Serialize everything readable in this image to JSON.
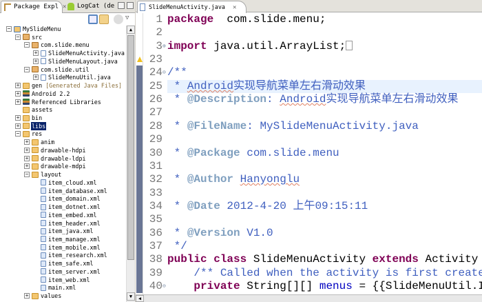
{
  "left_panel": {
    "tabs": [
      {
        "label": "Package Expl",
        "close": "✕",
        "icon": "package-explorer-icon"
      },
      {
        "label": "LogCat (depr",
        "icon": "android-icon"
      }
    ],
    "tree": [
      {
        "level": 0,
        "toggle": "-",
        "icon": "proj",
        "label": "MySlideMenu"
      },
      {
        "level": 1,
        "toggle": "-",
        "icon": "pkg",
        "label": "src"
      },
      {
        "level": 2,
        "toggle": "-",
        "icon": "pkg",
        "label": "com.slide.menu"
      },
      {
        "level": 3,
        "toggle": "+",
        "icon": "java",
        "label": "SlideMenuActivity.java"
      },
      {
        "level": 3,
        "toggle": "+",
        "icon": "java",
        "label": "SlideMenuLayout.java"
      },
      {
        "level": 2,
        "toggle": "-",
        "icon": "pkg",
        "label": "com.slide.util"
      },
      {
        "level": 3,
        "toggle": "+",
        "icon": "java",
        "label": "SlideMenuUtil.java"
      },
      {
        "level": 1,
        "toggle": "+",
        "icon": "folder",
        "label": "gen",
        "extra": "[Generated Java Files]"
      },
      {
        "level": 1,
        "toggle": "+",
        "icon": "lib",
        "label": "Android 2.2"
      },
      {
        "level": 1,
        "toggle": "+",
        "icon": "lib",
        "label": "Referenced Libraries"
      },
      {
        "level": 1,
        "toggle": "",
        "icon": "folder",
        "label": "assets"
      },
      {
        "level": 1,
        "toggle": "+",
        "icon": "folder",
        "label": "bin"
      },
      {
        "level": 1,
        "toggle": "+",
        "icon": "folder",
        "label": "libs",
        "selected": true
      },
      {
        "level": 1,
        "toggle": "-",
        "icon": "folder",
        "label": "res"
      },
      {
        "level": 2,
        "toggle": "+",
        "icon": "folder",
        "label": "anim"
      },
      {
        "level": 2,
        "toggle": "+",
        "icon": "folder",
        "label": "drawable-hdpi"
      },
      {
        "level": 2,
        "toggle": "+",
        "icon": "folder",
        "label": "drawable-ldpi"
      },
      {
        "level": 2,
        "toggle": "+",
        "icon": "folder",
        "label": "drawable-mdpi"
      },
      {
        "level": 2,
        "toggle": "-",
        "icon": "folder",
        "label": "layout"
      },
      {
        "level": 3,
        "toggle": "",
        "icon": "xml",
        "label": "item_cloud.xml"
      },
      {
        "level": 3,
        "toggle": "",
        "icon": "xml",
        "label": "item_database.xml"
      },
      {
        "level": 3,
        "toggle": "",
        "icon": "xml",
        "label": "item_domain.xml"
      },
      {
        "level": 3,
        "toggle": "",
        "icon": "xml",
        "label": "item_dotnet.xml"
      },
      {
        "level": 3,
        "toggle": "",
        "icon": "xml",
        "label": "item_embed.xml"
      },
      {
        "level": 3,
        "toggle": "",
        "icon": "xml",
        "label": "item_header.xml"
      },
      {
        "level": 3,
        "toggle": "",
        "icon": "xml",
        "label": "item_java.xml"
      },
      {
        "level": 3,
        "toggle": "",
        "icon": "xml",
        "label": "item_manage.xml"
      },
      {
        "level": 3,
        "toggle": "",
        "icon": "xml",
        "label": "item_mobile.xml"
      },
      {
        "level": 3,
        "toggle": "",
        "icon": "xml",
        "label": "item_research.xml"
      },
      {
        "level": 3,
        "toggle": "",
        "icon": "xml",
        "label": "item_safe.xml"
      },
      {
        "level": 3,
        "toggle": "",
        "icon": "xml",
        "label": "item_server.xml"
      },
      {
        "level": 3,
        "toggle": "",
        "icon": "xml",
        "label": "item_web.xml"
      },
      {
        "level": 3,
        "toggle": "",
        "icon": "xml",
        "label": "main.xml"
      },
      {
        "level": 2,
        "toggle": "+",
        "icon": "folder",
        "label": "values"
      }
    ]
  },
  "editor": {
    "tab_label": "SlideMenuActivity.java",
    "tab_close": "✕",
    "lines": [
      {
        "n": "1",
        "seg": [
          [
            "kw",
            "package"
          ],
          [
            "",
            "  com.slide.menu;"
          ]
        ]
      },
      {
        "n": "2",
        "seg": []
      },
      {
        "n": "3",
        "fold": "+",
        "seg": [
          [
            "kw",
            "import"
          ],
          [
            "",
            " java.util.ArrayList;"
          ]
        ],
        "box": true
      },
      {
        "n": "23",
        "seg": []
      },
      {
        "n": "24",
        "fold": "-",
        "seg": [
          [
            "jd",
            "/**"
          ]
        ]
      },
      {
        "n": "25",
        "hl": true,
        "seg": [
          [
            "jd",
            " * "
          ],
          [
            "jd sq",
            "Android"
          ],
          [
            "jd",
            "实现导航菜单左右滑动效果"
          ]
        ]
      },
      {
        "n": "26",
        "seg": [
          [
            "jd",
            " * "
          ],
          [
            "tag",
            "@Description"
          ],
          [
            "jd",
            ": "
          ],
          [
            "jd sq",
            "Android"
          ],
          [
            "jd",
            "实现导航菜单左右滑动效果"
          ]
        ]
      },
      {
        "n": "27",
        "seg": []
      },
      {
        "n": "28",
        "seg": [
          [
            "jd",
            " * "
          ],
          [
            "tag",
            "@FileName"
          ],
          [
            "jd",
            ": MySlideMenuActivity.java"
          ]
        ]
      },
      {
        "n": "29",
        "seg": []
      },
      {
        "n": "30",
        "seg": [
          [
            "jd",
            " * "
          ],
          [
            "tag",
            "@Package"
          ],
          [
            "jd",
            " com.slide.menu"
          ]
        ]
      },
      {
        "n": "31",
        "seg": []
      },
      {
        "n": "32",
        "seg": [
          [
            "jd",
            " * "
          ],
          [
            "tag",
            "@Author"
          ],
          [
            "jd",
            " "
          ],
          [
            "jd sq",
            "Hanyonglu"
          ]
        ]
      },
      {
        "n": "33",
        "seg": []
      },
      {
        "n": "34",
        "seg": [
          [
            "jd",
            " * "
          ],
          [
            "tag",
            "@Date"
          ],
          [
            "jd",
            " 2012-4-20 上午09:15:11"
          ]
        ]
      },
      {
        "n": "35",
        "seg": []
      },
      {
        "n": "36",
        "seg": [
          [
            "jd",
            " * "
          ],
          [
            "tag",
            "@Version"
          ],
          [
            "jd",
            " V1.0"
          ]
        ]
      },
      {
        "n": "37",
        "seg": [
          [
            "jd",
            " */"
          ]
        ]
      },
      {
        "n": "38",
        "seg": [
          [
            "kw",
            "public"
          ],
          [
            "",
            " "
          ],
          [
            "kw",
            "class"
          ],
          [
            "",
            " SlideMenuActivity "
          ],
          [
            "kw",
            "extends"
          ],
          [
            "",
            " Activity {"
          ]
        ]
      },
      {
        "n": "39",
        "seg": [
          [
            "",
            "    "
          ],
          [
            "jd",
            "/** Called when the activity is first created. */"
          ]
        ]
      },
      {
        "n": "40",
        "fold": "-",
        "seg": [
          [
            "",
            "    "
          ],
          [
            "kw",
            "private"
          ],
          [
            "",
            " String[][] "
          ],
          [
            "fld",
            "menus"
          ],
          [
            "",
            " = {{SlideMenuUtil.ITEM_MOBILE"
          ]
        ]
      }
    ]
  }
}
